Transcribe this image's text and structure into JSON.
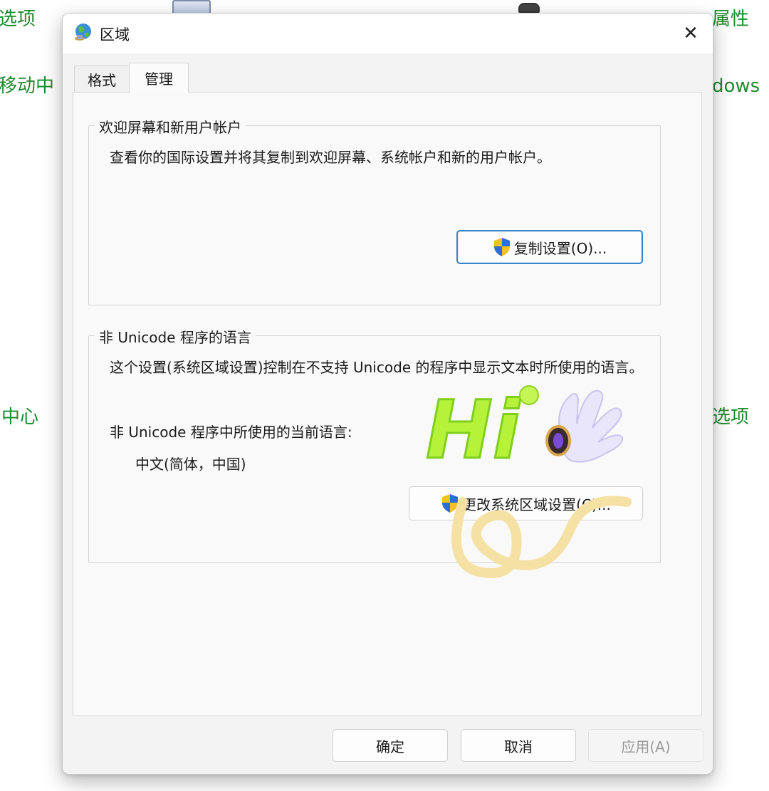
{
  "background": {
    "left_fragments": [
      "选项",
      "移动中",
      "中心"
    ],
    "right_fragments": [
      "属性",
      "dows",
      "选项"
    ]
  },
  "dialog": {
    "title": "区域",
    "close_glyph": "✕",
    "tabs": [
      {
        "label": "格式",
        "active": false
      },
      {
        "label": "管理",
        "active": true
      }
    ],
    "welcome": {
      "legend": "欢迎屏幕和新用户帐户",
      "description": "查看你的国际设置并将其复制到欢迎屏幕、系统帐户和新的用户帐户。",
      "button_label": "复制设置(O)..."
    },
    "non_unicode": {
      "legend": "非 Unicode 程序的语言",
      "description": "这个设置(系统区域设置)控制在不支持 Unicode 的程序中显示文本时所使用的语言。",
      "current_label": "非 Unicode 程序中所使用的当前语言:",
      "current_value": "中文(简体，中国)",
      "button_label": "更改系统区域设置(C)..."
    },
    "footer": {
      "ok": "确定",
      "cancel": "取消",
      "apply": "应用(A)"
    }
  },
  "sticker": {
    "text": "Hi"
  },
  "colors": {
    "background_text": "#1f8a2e",
    "focus_border": "#3a86c8",
    "sticker_green": "#b6f23a",
    "sticker_squiggle": "#f6e1a4"
  },
  "icons": {
    "title": "globe-icon",
    "close": "close-icon",
    "button_shield": "uac-shield-icon"
  }
}
